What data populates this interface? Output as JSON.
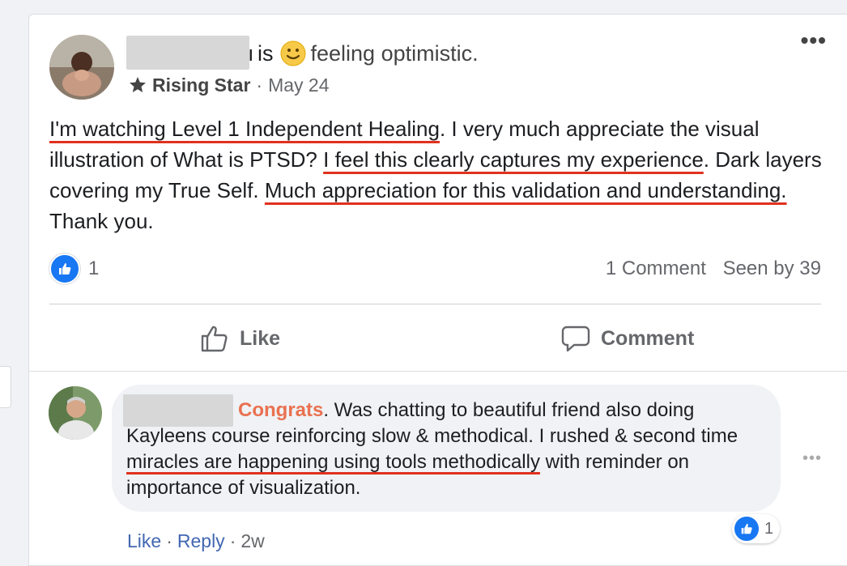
{
  "post": {
    "header": {
      "name_fragment": "ı",
      "verb": "is",
      "feeling_icon": "slightly-smiling-face-icon",
      "feeling": "feeling optimistic."
    },
    "subline": {
      "badge_icon": "rising-star-icon",
      "badge": "Rising Star",
      "separator": "·",
      "date": "May 24"
    },
    "more_label": "•••",
    "body": [
      {
        "text": "I'm watching Level 1 Independent Healing",
        "highlight": true
      },
      {
        "text": ". I very much appreciate the visual illustration of What is PTSD? ",
        "highlight": false
      },
      {
        "text": "I feel this clearly captures my experience",
        "highlight": true
      },
      {
        "text": ". Dark layers covering my True Self. ",
        "highlight": false
      },
      {
        "text": "Much appreciation for this validation and understanding.",
        "highlight": true
      },
      {
        "text": " Thank you.",
        "highlight": false
      }
    ],
    "reactions": {
      "icon": "like-reaction-icon",
      "count": "1"
    },
    "meta": {
      "comments": "1 Comment",
      "seen": "Seen by 39"
    },
    "actions": {
      "like_label": "Like",
      "like_icon": "thumbs-up-outline-icon",
      "comment_label": "Comment",
      "comment_icon": "comment-bubble-icon"
    }
  },
  "comment": {
    "congrats": "Congrats",
    "body_parts": [
      {
        "text": ". Was chatting to beautiful friend also doing Kayleens course reinforcing slow & methodical. I rushed & second time ",
        "highlight": false
      },
      {
        "text": "miracles are happening using tools methodically",
        "highlight": true
      },
      {
        "text": " with reminder on importance of visualization.",
        "highlight": false
      }
    ],
    "more_label": "•••",
    "reaction_count": "1",
    "actions": {
      "like": "Like",
      "reply": "Reply",
      "sep": "·",
      "time": "2w"
    }
  },
  "colors": {
    "brand_blue": "#1877f2",
    "link_blue": "#4267b2",
    "highlight_red": "#e0311f",
    "congrats_orange": "#e9714f"
  }
}
